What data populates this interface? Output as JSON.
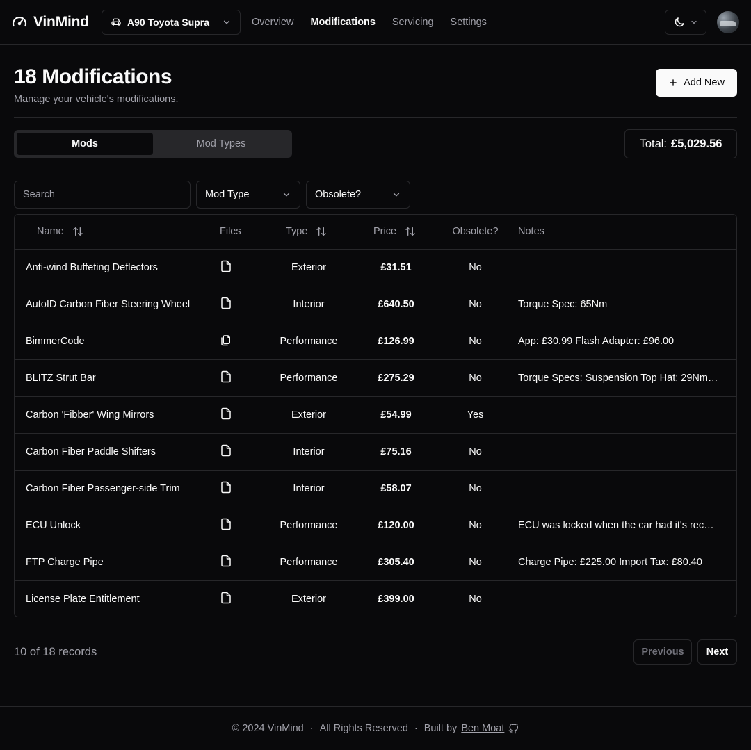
{
  "header": {
    "brand": "VinMind",
    "car_select": "A90 Toyota Supra",
    "nav": [
      "Overview",
      "Modifications",
      "Servicing",
      "Settings"
    ],
    "nav_active": "Modifications"
  },
  "page": {
    "title": "18 Modifications",
    "subtitle": "Manage your vehicle's modifications.",
    "add_button": "Add New"
  },
  "tabs": [
    "Mods",
    "Mod Types"
  ],
  "total": {
    "label": "Total:",
    "value": "£5,029.56"
  },
  "filters": {
    "search_placeholder": "Search",
    "mod_type": "Mod Type",
    "obsolete": "Obsolete?"
  },
  "table": {
    "columns": [
      "Name",
      "Files",
      "Type",
      "Price",
      "Obsolete?",
      "Notes"
    ],
    "rows": [
      {
        "name": "Anti-wind Buffeting Deflectors",
        "files": "single",
        "type": "Exterior",
        "price": "£31.51",
        "obsolete": "No",
        "notes": ""
      },
      {
        "name": "AutoID Carbon Fiber Steering Wheel",
        "files": "single",
        "type": "Interior",
        "price": "£640.50",
        "obsolete": "No",
        "notes": "Torque Spec: 65Nm"
      },
      {
        "name": "BimmerCode",
        "files": "multiple",
        "type": "Performance",
        "price": "£126.99",
        "obsolete": "No",
        "notes": "App: £30.99 Flash Adapter: £96.00"
      },
      {
        "name": "BLITZ Strut Bar",
        "files": "single",
        "type": "Performance",
        "price": "£275.29",
        "obsolete": "No",
        "notes": "Torque Specs: Suspension Top Hat: 29Nm ..."
      },
      {
        "name": "Carbon 'Fibber' Wing Mirrors",
        "files": "single",
        "type": "Exterior",
        "price": "£54.99",
        "obsolete": "Yes",
        "notes": ""
      },
      {
        "name": "Carbon Fiber Paddle Shifters",
        "files": "single",
        "type": "Interior",
        "price": "£75.16",
        "obsolete": "No",
        "notes": ""
      },
      {
        "name": "Carbon Fiber Passenger-side Trim",
        "files": "single",
        "type": "Interior",
        "price": "£58.07",
        "obsolete": "No",
        "notes": ""
      },
      {
        "name": "ECU Unlock",
        "files": "single",
        "type": "Performance",
        "price": "£120.00",
        "obsolete": "No",
        "notes": "ECU was locked when the car had it's recall..."
      },
      {
        "name": "FTP Charge Pipe",
        "files": "single",
        "type": "Performance",
        "price": "£305.40",
        "obsolete": "No",
        "notes": "Charge Pipe: £225.00 Import Tax: £80.40"
      },
      {
        "name": "License Plate Entitlement",
        "files": "single",
        "type": "Exterior",
        "price": "£399.00",
        "obsolete": "No",
        "notes": ""
      }
    ]
  },
  "pagination": {
    "records": "10 of 18 records",
    "previous": "Previous",
    "next": "Next"
  },
  "footer": {
    "copyright": "© 2024 VinMind",
    "rights": "All Rights Reserved",
    "built_by": "Built by",
    "author": "Ben Moat"
  }
}
